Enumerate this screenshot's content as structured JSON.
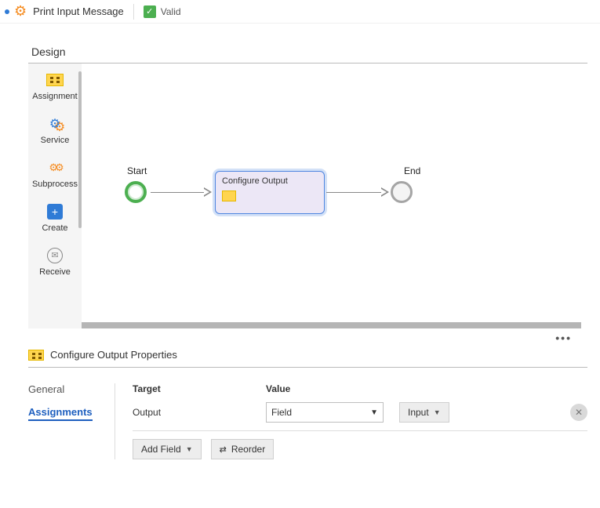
{
  "topbar": {
    "title": "Print Input Message",
    "status_label": "Valid"
  },
  "design": {
    "panel_title": "Design",
    "palette": [
      {
        "key": "assignment",
        "label": "Assignment"
      },
      {
        "key": "service",
        "label": "Service"
      },
      {
        "key": "subprocess",
        "label": "Subprocess"
      },
      {
        "key": "create",
        "label": "Create"
      },
      {
        "key": "receive",
        "label": "Receive"
      }
    ],
    "canvas": {
      "start_label": "Start",
      "end_label": "End",
      "task_label": "Configure Output"
    }
  },
  "properties": {
    "title": "Configure Output Properties",
    "tabs": {
      "general": "General",
      "assignments": "Assignments"
    },
    "active_tab": "assignments",
    "headers": {
      "target": "Target",
      "value": "Value"
    },
    "row": {
      "target_label": "Output",
      "value_select": "Field",
      "value_button": "Input"
    },
    "buttons": {
      "add_field": "Add Field",
      "reorder": "Reorder"
    }
  }
}
